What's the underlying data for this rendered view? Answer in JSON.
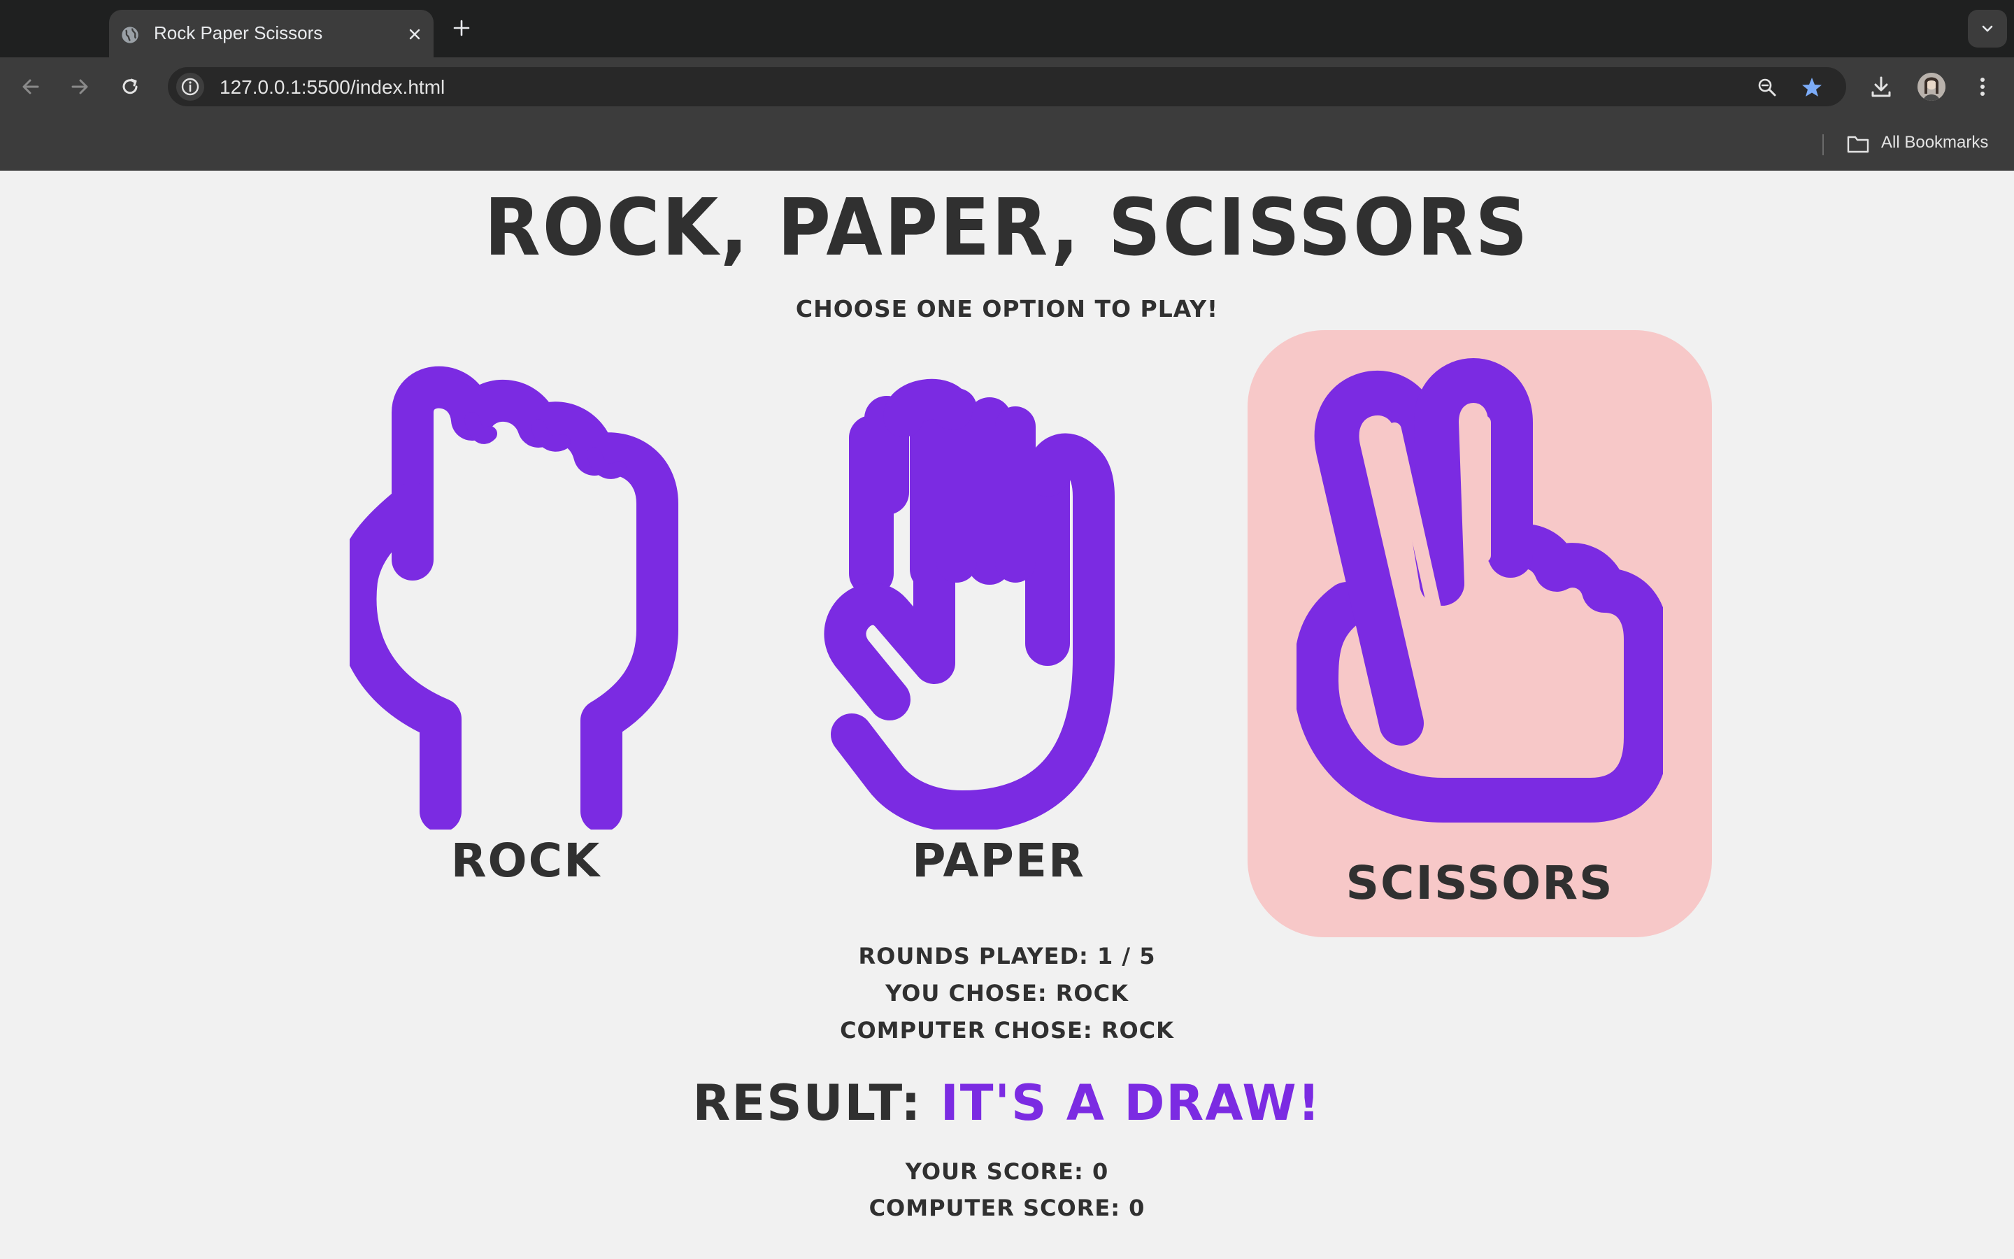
{
  "browser": {
    "tab_title": "Rock Paper Scissors",
    "url": "127.0.0.1:5500/index.html",
    "bookmarks_label": "All Bookmarks"
  },
  "game": {
    "title": "Rock, Paper, Scissors",
    "subtitle": "Choose one option to play!",
    "choices": [
      {
        "label": "Rock",
        "icon": "rock-hand-icon"
      },
      {
        "label": "Paper",
        "icon": "paper-hand-icon"
      },
      {
        "label": "Scissors",
        "icon": "scissors-hand-icon"
      }
    ],
    "selected": "Scissors",
    "accent_color": "#7b2be2",
    "highlight_color": "#f7c8c8",
    "text_color": "#303030",
    "rounds_played": "Rounds played: 1 / 5",
    "you_chose": "You chose: rock",
    "computer_chose": "Computer chose: rock",
    "result_label": "Result:",
    "result_value": "It's a Draw!",
    "your_score": "Your score: 0",
    "computer_score": "Computer score: 0"
  }
}
